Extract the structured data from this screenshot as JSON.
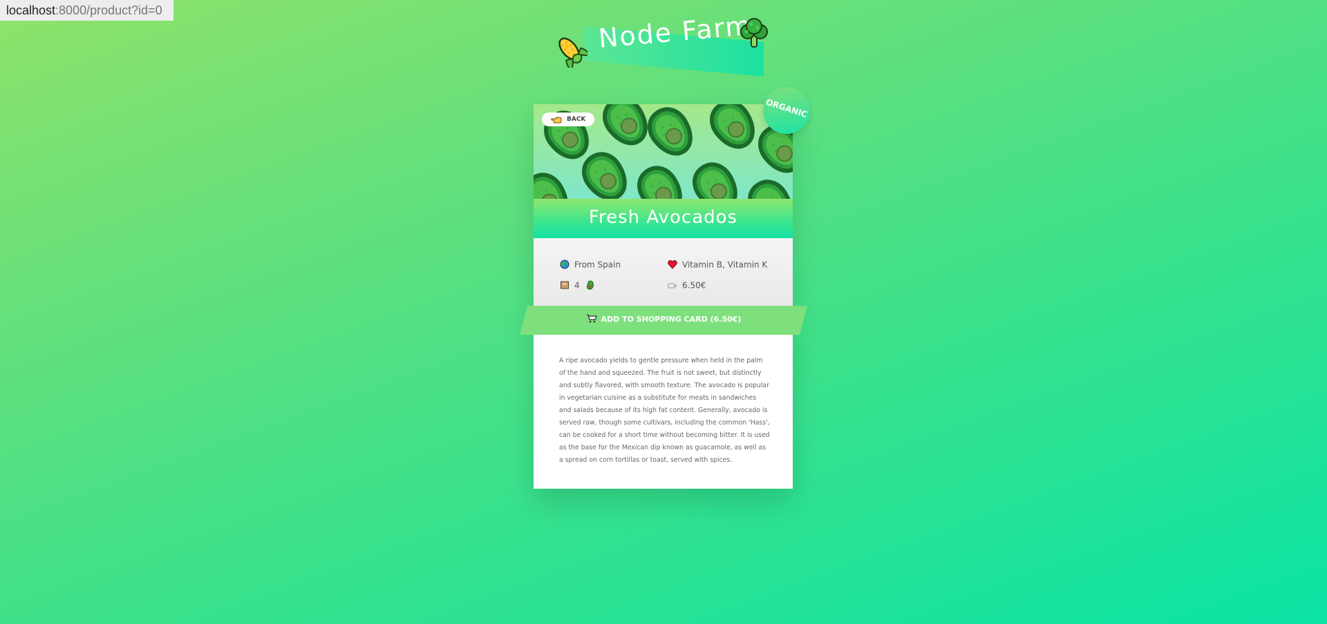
{
  "browser": {
    "url_host": "localhost",
    "url_path": ":8000/product?id=0"
  },
  "header": {
    "logo_text": "Node Farm",
    "left_icon": "corn-icon",
    "right_icon": "broccoli-icon"
  },
  "product": {
    "back_label": "BACK",
    "badge": "ORGANIC",
    "name": "Fresh Avocados",
    "from": "From Spain",
    "nutrients": "Vitamin B, Vitamin K",
    "quantity": "4",
    "price": "6.50€",
    "cart_label": "ADD TO SHOPPING CARD (6.50€)",
    "description": "A ripe avocado yields to gentle pressure when held in the palm of the hand and squeezed. The fruit is not sweet, but distinctly and subtly flavored, with smooth texture. The avocado is popular in vegetarian cuisine as a substitute for meats in sandwiches and salads because of its high fat content. Generally, avocado is served raw, though some cultivars, including the common 'Hass', can be cooked for a short time without becoming bitter. It is used as the base for the Mexican dip known as guacamole, as well as a spread on corn tortillas or toast, served with spices."
  },
  "colors": {
    "accent": "#7ee07d",
    "gradient_start": "#8fe36a",
    "gradient_end": "#0ae3a4"
  }
}
